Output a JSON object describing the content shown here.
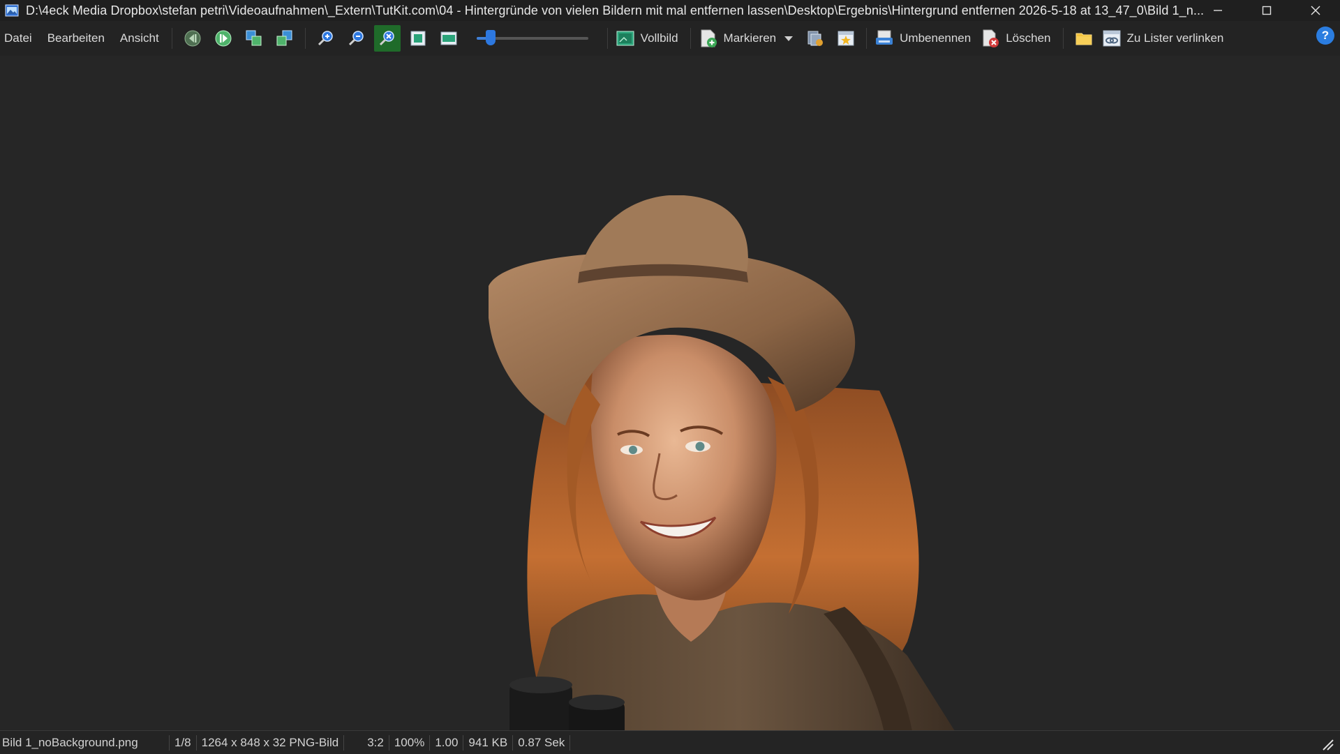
{
  "window": {
    "title": "D:\\4eck Media Dropbox\\stefan petri\\Videoaufnahmen\\_Extern\\TutKit.com\\04 - Hintergründe von vielen Bildern mit mal entfernen lassen\\Desktop\\Ergebnis\\Hintergrund entfernen 2026-5-18 at 13_47_0\\Bild 1_n...",
    "controls": [
      "minimize-icon",
      "maximize-icon",
      "close-icon"
    ]
  },
  "menu": {
    "file": "Datei",
    "edit": "Bearbeiten",
    "view": "Ansicht"
  },
  "toolbar": {
    "zoom_slider_fraction": 0.13,
    "fullscreen": "Vollbild",
    "mark": "Markieren",
    "rename": "Umbenennen",
    "delete": "Löschen",
    "link_lister": "Zu Lister verlinken",
    "help": "?",
    "accent_color": "#2b7de0",
    "active_button_color": "#1f6b2a"
  },
  "viewer": {
    "background": "#262626",
    "image_alt": "woman-with-hat-and-binoculars"
  },
  "status": {
    "filename": "Bild 1_noBackground.png",
    "index": "1/8",
    "dimensions": "1264 x 848 x 32 PNG-Bild",
    "aspect": "3:2",
    "zoom": "100%",
    "ratio": "1.00",
    "filesize": "941 KB",
    "load_time": "0.87 Sek"
  }
}
